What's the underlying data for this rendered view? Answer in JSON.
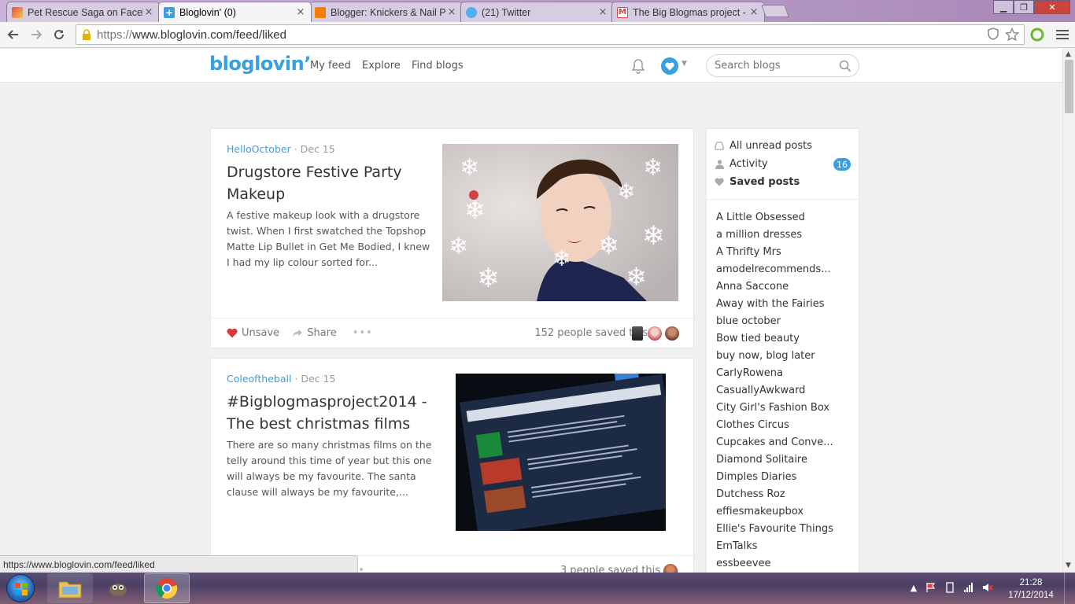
{
  "browser": {
    "tabs": [
      {
        "title": "Pet Rescue Saga on Faceb",
        "icon": "pet-rescue-favicon",
        "active": false
      },
      {
        "title": "Bloglovin' (0)",
        "icon": "bloglovin-favicon",
        "active": true
      },
      {
        "title": "Blogger: Knickers & Nail P",
        "icon": "blogger-favicon",
        "active": false
      },
      {
        "title": "(21) Twitter",
        "icon": "twitter-favicon",
        "active": false
      },
      {
        "title": "The Big Blogmas project -",
        "icon": "gmail-favicon",
        "active": false
      }
    ],
    "tab_close": "×",
    "url_scheme": "https://",
    "url_rest": "www.bloglovin.com/feed/liked",
    "status_url": "https://www.bloglovin.com/feed/liked",
    "colors": {
      "accent": "#38a0df",
      "heart": "#d9383a"
    }
  },
  "site": {
    "logo": "bloglovin’",
    "nav": [
      "My feed",
      "Explore",
      "Find blogs"
    ],
    "search_placeholder": "Search blogs"
  },
  "posts": [
    {
      "blog": "HelloOctober",
      "date": "· Dec 15",
      "title": "Drugstore Festive Party Makeup",
      "excerpt": "A festive makeup look with a drugstore twist. When I first swatched the Topshop Matte Lip Bullet in Get Me Bodied, I knew I had my lip colour sorted for...",
      "actions": {
        "unsave": "Unsave",
        "share": "Share",
        "more": "•••"
      },
      "saved_text": "152 people saved this"
    },
    {
      "blog": "Coleoftheball",
      "date": "· Dec 15",
      "title": "#Bigblogmasproject2014 - The best christmas films",
      "excerpt": "There are so many christmas films on the telly around this time of year but this one will always be my favourite. The santa clause will always be my favourite,...",
      "actions": {
        "more": "•••"
      },
      "saved_text": "3 people saved this"
    }
  ],
  "sidebar": {
    "items": [
      {
        "label": "All unread posts",
        "icon": "inbox-icon"
      },
      {
        "label": "Activity",
        "icon": "person-icon",
        "badge": "16"
      },
      {
        "label": "Saved posts",
        "icon": "heart-icon"
      }
    ],
    "blogs": [
      "A Little Obsessed",
      "a million dresses",
      "A Thrifty Mrs",
      "amodelrecommends...",
      "Anna Saccone",
      "Away with the Fairies",
      "blue october",
      "Bow tied beauty",
      "buy now, blog later",
      "CarlyRowena",
      "CasuallyAwkward",
      "City Girl's Fashion Box",
      "Clothes Circus",
      "Cupcakes and Conve...",
      "Diamond Solitaire",
      "Dimples Diaries",
      "Dutchess Roz",
      "effiesmakeupbox",
      "Ellie's Favourite Things",
      "EmTalks",
      "essbeevee"
    ]
  },
  "taskbar": {
    "time": "21:28",
    "date": "17/12/2014"
  }
}
